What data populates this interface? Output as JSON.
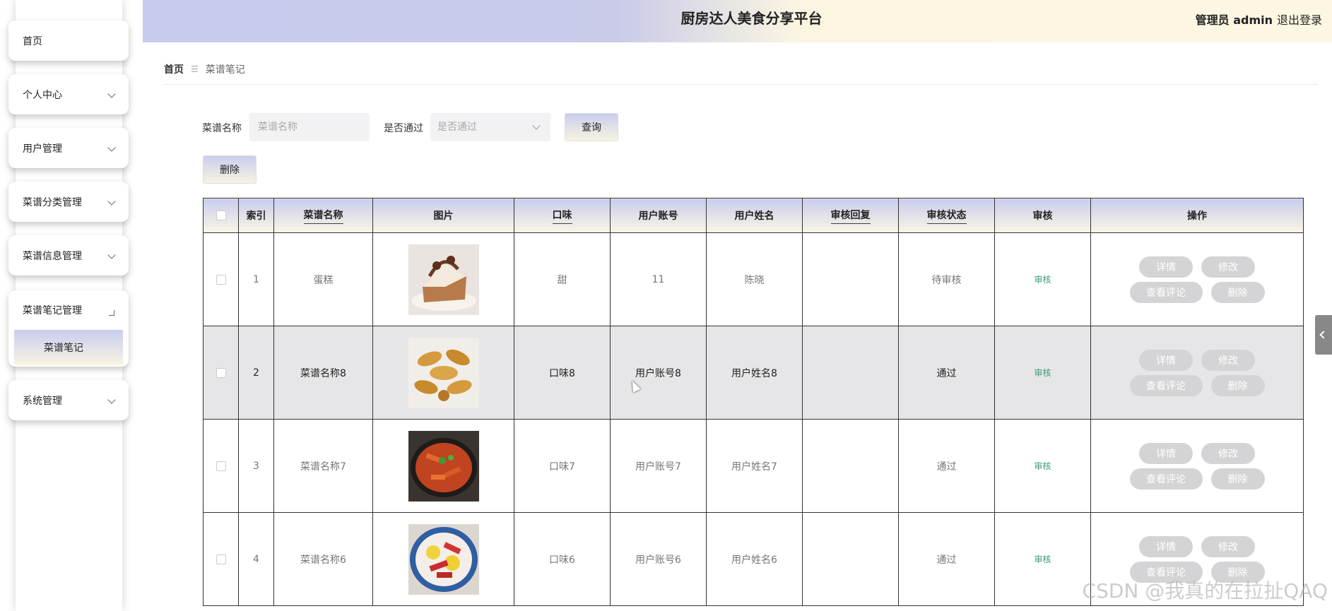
{
  "header": {
    "title": "厨房达人美食分享平台",
    "user_label": "管理员 admin",
    "logout_label": "退出登录"
  },
  "sidebar": {
    "items": [
      {
        "label": "首页",
        "has_arrow": false
      },
      {
        "label": "个人中心",
        "has_arrow": true
      },
      {
        "label": "用户管理",
        "has_arrow": true
      },
      {
        "label": "菜谱分类管理",
        "has_arrow": true
      },
      {
        "label": "菜谱信息管理",
        "has_arrow": true
      },
      {
        "label": "菜谱笔记管理",
        "has_arrow": true,
        "expanded": true,
        "children": [
          "菜谱笔记"
        ]
      },
      {
        "label": "系统管理",
        "has_arrow": true
      }
    ]
  },
  "breadcrumb": {
    "home": "首页",
    "separator": "☰",
    "current": "菜谱笔记"
  },
  "search": {
    "name_label": "菜谱名称",
    "name_placeholder": "菜谱名称",
    "pass_label": "是否通过",
    "pass_placeholder": "是否通过",
    "query_button": "查询",
    "delete_button": "删除"
  },
  "table": {
    "columns": [
      "索引",
      "菜谱名称",
      "图片",
      "口味",
      "用户账号",
      "用户姓名",
      "审核回复",
      "审核状态",
      "审核",
      "操作"
    ],
    "rows": [
      {
        "index": "1",
        "name": "蛋糕",
        "image": "cake",
        "taste": "甜",
        "account": "11",
        "username": "陈晓",
        "reply": "",
        "status": "待审核",
        "audit": "审核"
      },
      {
        "index": "2",
        "name": "菜谱名称8",
        "image": "bread-rolls",
        "taste": "口味8",
        "account": "用户账号8",
        "username": "用户姓名8",
        "reply": "",
        "status": "通过",
        "audit": "审核"
      },
      {
        "index": "3",
        "name": "菜谱名称7",
        "image": "braised-dish",
        "taste": "口味7",
        "account": "用户账号7",
        "username": "用户姓名7",
        "reply": "",
        "status": "通过",
        "audit": "审核"
      },
      {
        "index": "4",
        "name": "菜谱名称6",
        "image": "sausage-egg",
        "taste": "口味6",
        "account": "用户账号6",
        "username": "用户姓名6",
        "reply": "",
        "status": "通过",
        "audit": "审核"
      }
    ],
    "ops": {
      "detail": "详情",
      "edit": "修改",
      "comments": "查看评论",
      "delete": "删除"
    }
  },
  "watermark": "CSDN @我真的在拉扯QAQ",
  "colors": {
    "gradient_start": "#c8cdee",
    "gradient_end": "#fbf6e4",
    "audit_green": "#3a9b76",
    "op_button": "#d4d4d6",
    "highlight_row": "#e6e6e8"
  }
}
